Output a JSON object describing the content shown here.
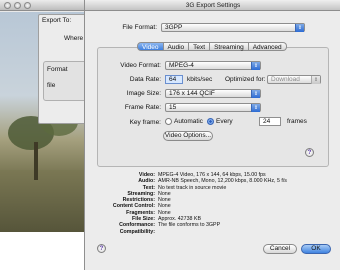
{
  "background_window": {
    "title": "3G Export Settings",
    "export_to_label": "Export To:",
    "where_label": "Where",
    "format_label": "Format",
    "file_label": "file"
  },
  "sheet": {
    "title": "3G Export Settings",
    "file_format_label": "File Format:",
    "file_format_value": "3GPP",
    "tabs": [
      {
        "label": "Video",
        "active": true
      },
      {
        "label": "Audio",
        "active": false
      },
      {
        "label": "Text",
        "active": false
      },
      {
        "label": "Streaming",
        "active": false
      },
      {
        "label": "Advanced",
        "active": false
      }
    ],
    "video": {
      "video_format_label": "Video Format:",
      "video_format_value": "MPEG-4",
      "data_rate_label": "Data Rate:",
      "data_rate_value": "64",
      "data_rate_unit": "kbits/sec",
      "optimized_for_label": "Optimized for:",
      "optimized_for_value": "Download",
      "image_size_label": "Image Size:",
      "image_size_value": "176 x 144 QCIF",
      "frame_rate_label": "Frame Rate:",
      "frame_rate_value": "15",
      "key_frame_label": "Key frame:",
      "automatic_label": "Automatic",
      "every_label": "Every",
      "every_value": "24",
      "frames_label": "frames",
      "video_options_label": "Video Options..."
    },
    "summary": [
      {
        "k": "Video:",
        "v": "MPEG-4 Video, 176 x 144, 64 kbps, 15.00 fps"
      },
      {
        "k": "Audio:",
        "v": "AMR-NB Speech, Mono, 12,200 kbps, 8.000 KHz, 5 f/s"
      },
      {
        "k": "Text:",
        "v": "No text track in source movie"
      },
      {
        "k": "Streaming:",
        "v": "None"
      },
      {
        "k": "Restrictions:",
        "v": "None"
      },
      {
        "k": "Content Control:",
        "v": "None"
      },
      {
        "k": "Fragments:",
        "v": "None"
      },
      {
        "k": "File Size:",
        "v": "Approx. 42738 KB"
      },
      {
        "k": "Conformance:",
        "v": "The file conforms to 3GPP"
      },
      {
        "k": "Compatibility:",
        "v": ""
      }
    ],
    "cancel_label": "Cancel",
    "ok_label": "OK",
    "help_symbol": "?"
  },
  "colors": {
    "accent": "#3e7fde",
    "window_bg": "#ececec"
  }
}
